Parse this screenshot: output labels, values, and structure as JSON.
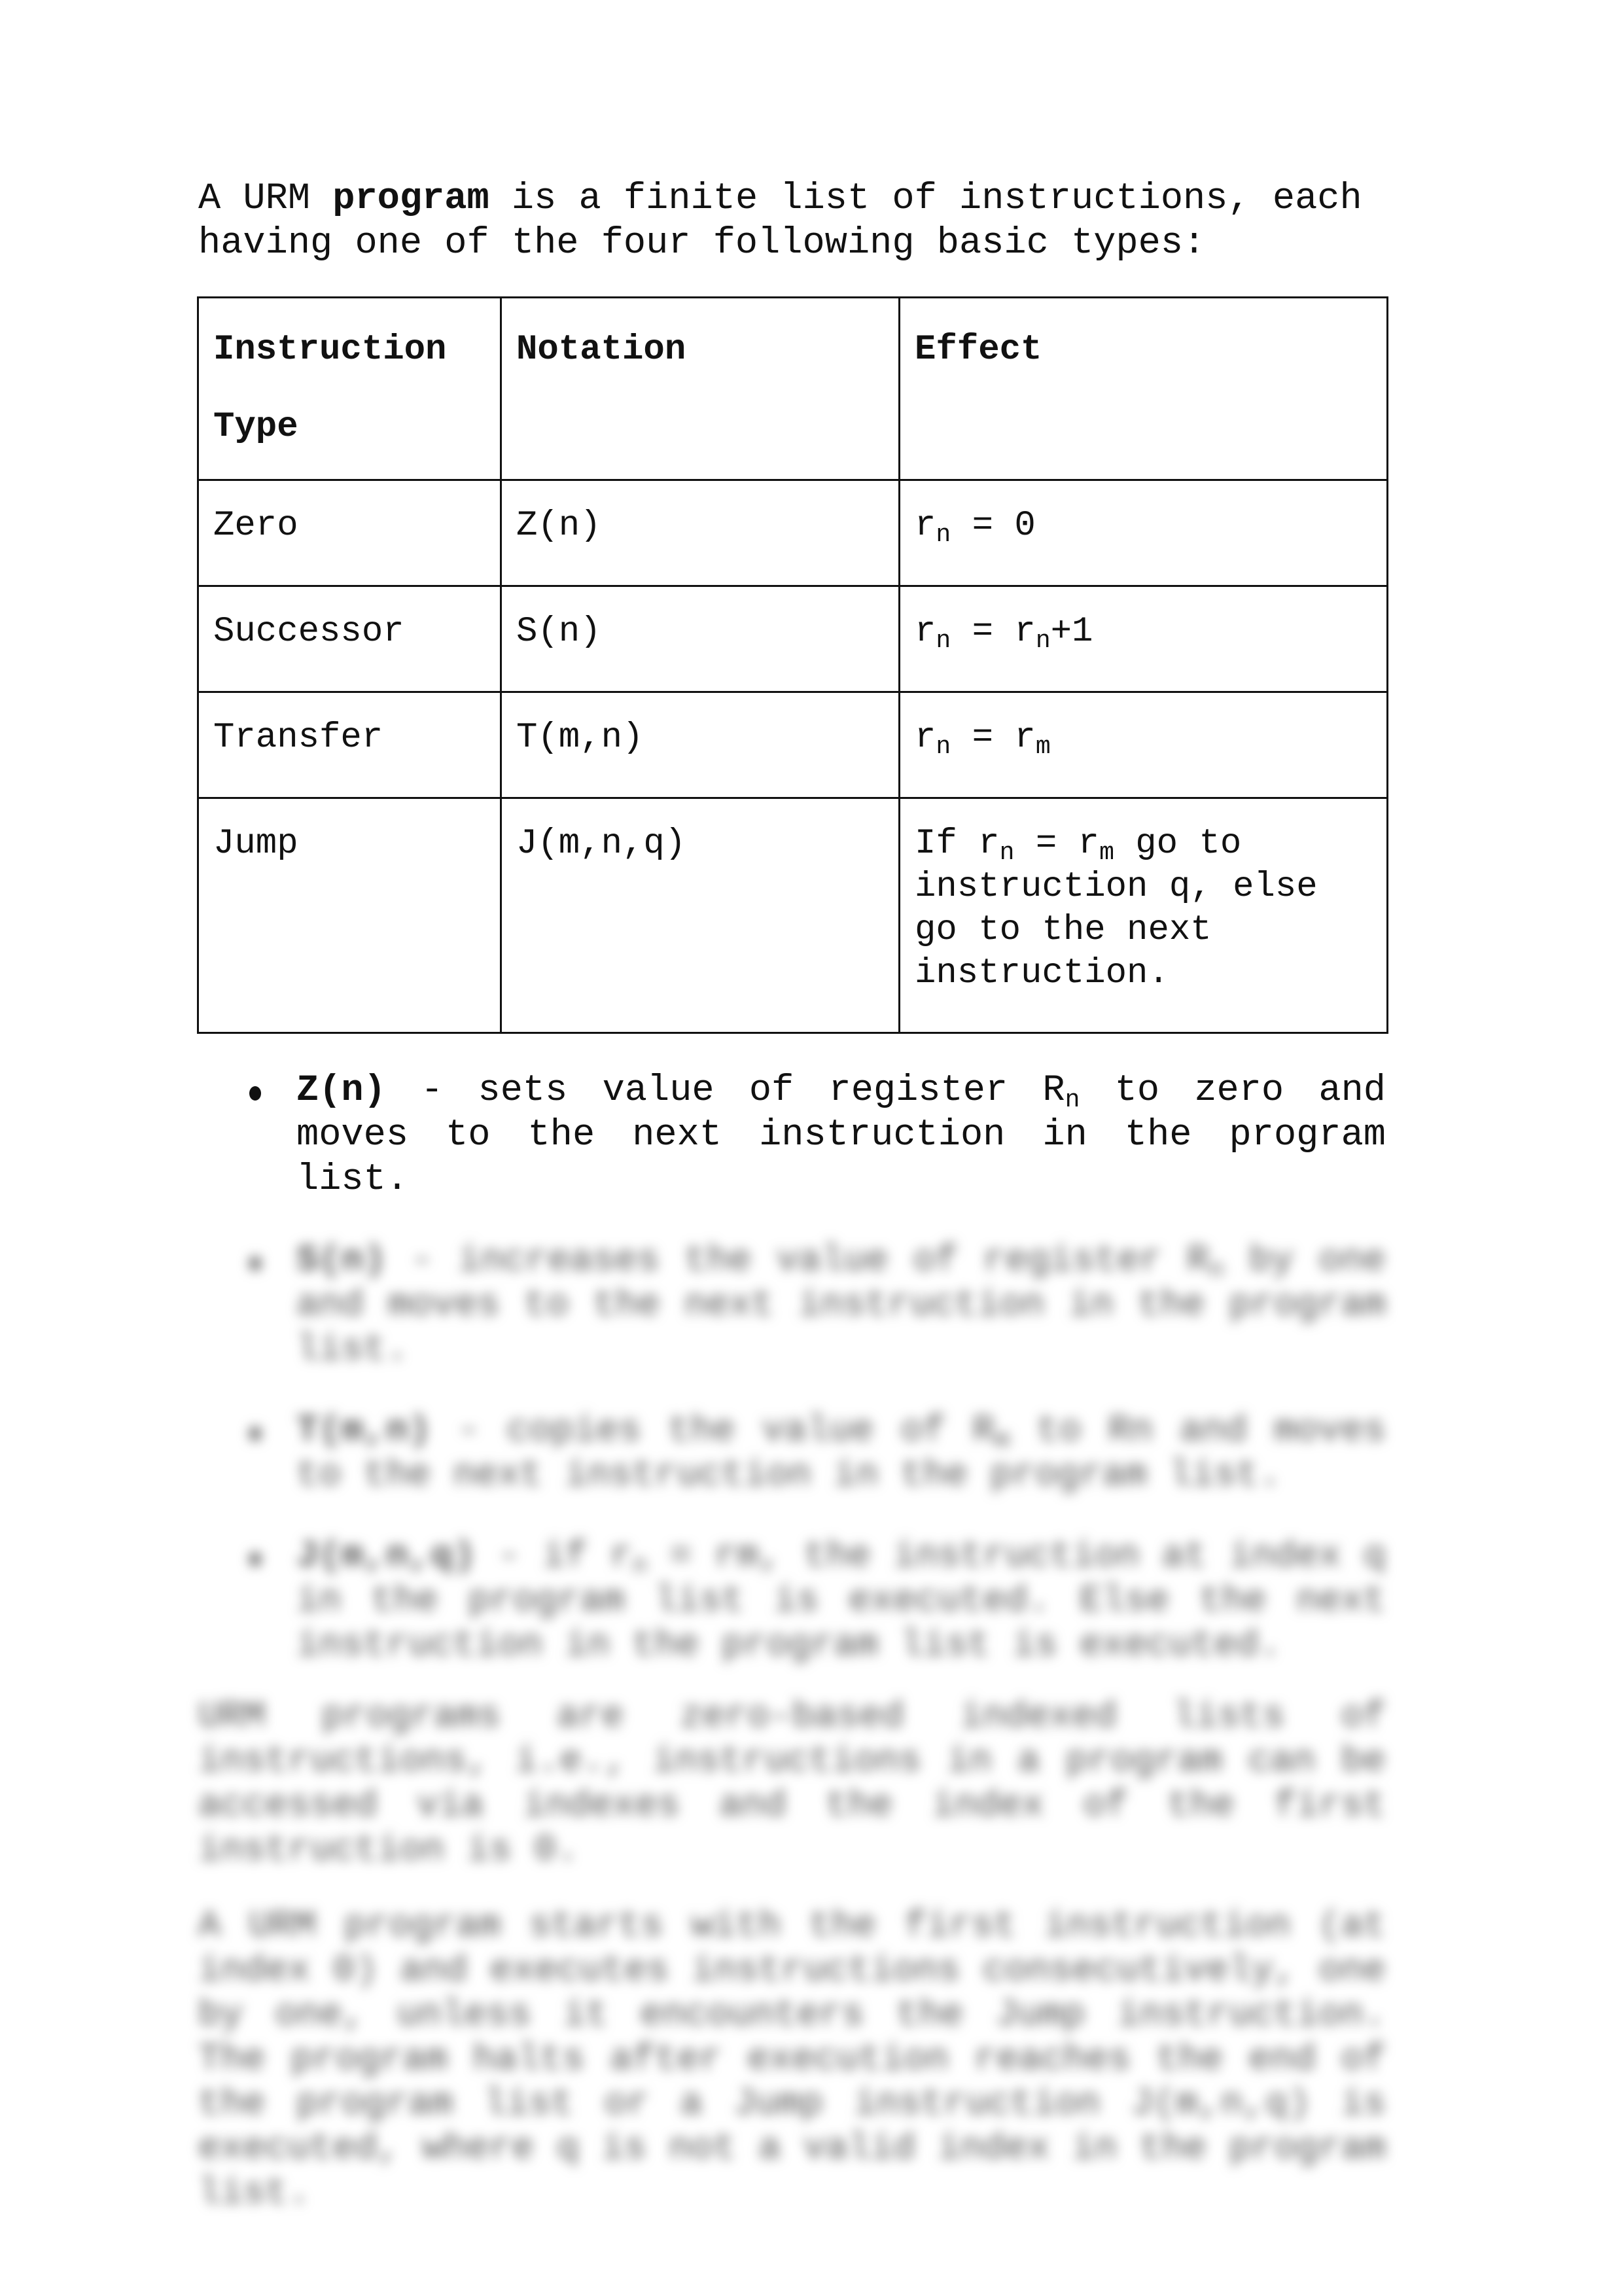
{
  "intro": {
    "before": "A URM ",
    "bold": "program",
    "after": " is a finite list of instructions, each having one of the four following basic types:"
  },
  "table": {
    "headers": [
      "Instruction Type",
      "Notation",
      "Effect"
    ],
    "header_line1": "Instruction",
    "header_line2": "Type",
    "rows": [
      {
        "type": "Zero",
        "notation": "Z(n)",
        "effect_parts": [
          "r",
          "n",
          " = 0"
        ]
      },
      {
        "type": "Successor",
        "notation": "S(n)",
        "effect_parts": [
          "r",
          "n",
          " = r",
          "n",
          "+1"
        ]
      },
      {
        "type": "Transfer",
        "notation": "T(m,n)",
        "effect_parts": [
          "r",
          "n",
          " = r",
          "m",
          ""
        ]
      },
      {
        "type": "Jump",
        "notation": "J(m,n,q)",
        "effect_parts": [
          "If r",
          "n",
          " = r",
          "m",
          " go to instruction q, else go to the next instruction."
        ]
      }
    ]
  },
  "bullets": [
    {
      "bold": "Z(n)",
      "text_before_sub": " - sets value of register R",
      "sub": "n",
      "text_after_sub": " to zero and moves to the next instruction in the program list.",
      "blurred": false
    },
    {
      "bold": "S(n)",
      "text_before_sub": " - increases the value of register R",
      "sub": "n",
      "text_after_sub": " by one and moves to the next instruction in the program list.",
      "blurred": true
    },
    {
      "bold": "T(m,n)",
      "text_before_sub": " - copies the value of R",
      "sub": "m",
      "text_after_sub": " to Rn and moves to the next instruction in the program list.",
      "blurred": true
    },
    {
      "bold": "J(m,n,q)",
      "text_before_sub": " - if r",
      "sub": "n",
      "text_after_sub": " = rm, the instruction at index q in the program list is executed. Else the next instruction in the program list is executed.",
      "blurred": true
    }
  ],
  "blurred_paragraphs": [
    "URM programs are zero-based indexed lists of instructions, i.e., instructions in a program can be accessed via indexes and the index of the first instruction is 0.",
    "A URM program starts with the first instruction (at index 0) and executes instructions consecutively, one by one, unless it encounters the Jump instruction. The program halts after execution reaches the end of the program list or a Jump instruction J(m,n,q) is executed, where q is not a valid index in the program list."
  ]
}
